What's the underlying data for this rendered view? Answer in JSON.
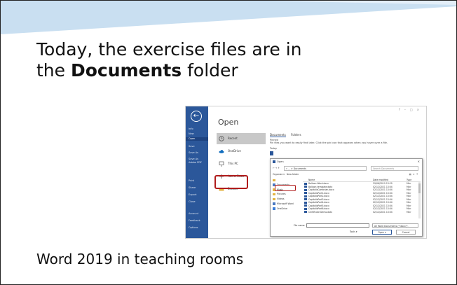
{
  "slide": {
    "title_line1": "Today, the exercise files are in",
    "title_pre": "the ",
    "title_bold": "Documents",
    "title_post": " folder",
    "caption": "Word 2019 in teaching rooms"
  },
  "screenshot": {
    "nav_items": [
      "Info",
      "New",
      "Open",
      "Save",
      "Save As",
      "Save As Adobe PDF",
      "Print",
      "Share",
      "Export",
      "Close",
      "Account",
      "Feedback",
      "Options"
    ],
    "open_title": "Open",
    "places": [
      "Recent",
      "OneDrive",
      "This PC",
      "Add a Place",
      "Browse"
    ],
    "recent_tabs": [
      "Documents",
      "Folders"
    ],
    "pinned_label": "Pinned",
    "pinned_text": "Pin files you want to easily find later. Click the pin icon that appears when you hover over a file.",
    "today_label": "Today",
    "dialog": {
      "title": "Open",
      "path": "« ... > Documents",
      "search_placeholder": "Search Documents",
      "organize": "Organize ▾",
      "new_folder": "New folder",
      "tree": [
        "Documents",
        "Music",
        "Pictures",
        "Videos",
        "Microsoft Word",
        "OneDrive"
      ],
      "col_name": "Name",
      "col_date": "Date modified",
      "col_type": "Type",
      "files": [
        {
          "name": "Balloon Word.docx",
          "date": "29/06/2019 13:20",
          "type": "Micr"
        },
        {
          "name": "Balloon template.dotx",
          "date": "02/12/2021 13:04",
          "type": "Micr"
        },
        {
          "name": "CapitalisCambrian.docx",
          "date": "02/12/2021 13:04",
          "type": "Micr"
        },
        {
          "name": "CapitalisPort1.docx",
          "date": "02/12/2021 13:04",
          "type": "Micr"
        },
        {
          "name": "CapitalisPort2.docx",
          "date": "02/12/2021 13:04",
          "type": "Micr"
        },
        {
          "name": "CapitalisPort3.docx",
          "date": "02/12/2021 13:04",
          "type": "Micr"
        },
        {
          "name": "CapitalisPort4.docx",
          "date": "02/12/2021 13:04",
          "type": "Micr"
        },
        {
          "name": "CapitalisPort5.docx",
          "date": "02/12/2021 13:04",
          "type": "Micr"
        },
        {
          "name": "CapitalisPort6.docx",
          "date": "02/12/2021 13:04",
          "type": "Micr"
        },
        {
          "name": "Certificate Demo.dotx",
          "date": "02/12/2021 13:04",
          "type": "Micr"
        }
      ],
      "file_name_label": "File name:",
      "file_type": "All Word Documents (*.docx;*.",
      "tools": "Tools ▾",
      "open_button": "Open ▾",
      "cancel_button": "Cancel"
    }
  },
  "colors": {
    "header_band": "#c9dff1",
    "word_blue": "#2b579a",
    "highlight_red": "#b01c1c"
  }
}
